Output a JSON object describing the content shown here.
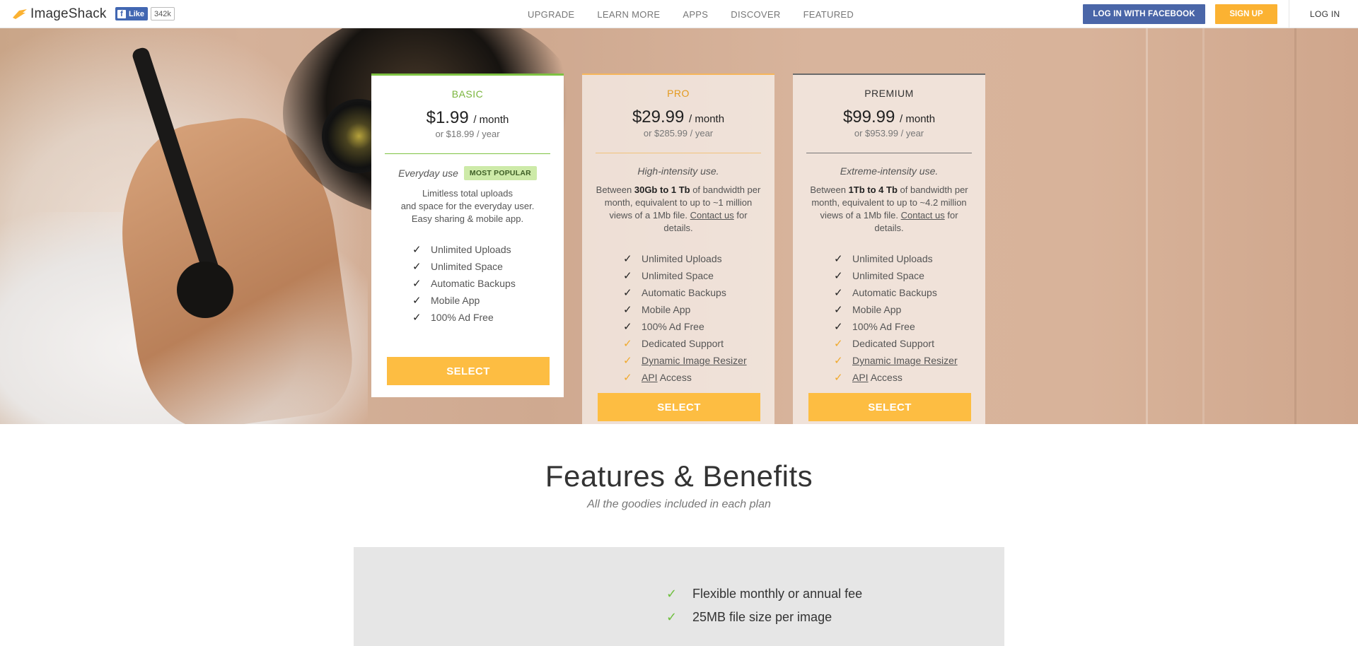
{
  "header": {
    "logo_text": "ImageShack",
    "fb_like_label": "Like",
    "fb_like_count": "342k",
    "nav": [
      "UPGRADE",
      "LEARN MORE",
      "APPS",
      "DISCOVER",
      "FEATURED"
    ],
    "login_facebook": "LOG IN WITH FACEBOOK",
    "signup": "SIGN UP",
    "login": "LOG IN"
  },
  "plans": {
    "basic": {
      "name": "BASIC",
      "price": "$1.99",
      "per": "/ month",
      "yearly": "or $18.99 / year",
      "use": "Everyday use",
      "badge": "MOST POPULAR",
      "desc_lines": [
        "Limitless total uploads",
        "and space for the everyday user.",
        "Easy sharing & mobile app."
      ],
      "features": [
        "Unlimited Uploads",
        "Unlimited Space",
        "Automatic Backups",
        "Mobile App",
        "100% Ad Free"
      ],
      "select": "SELECT"
    },
    "pro": {
      "name": "PRO",
      "price": "$29.99",
      "per": "/ month",
      "yearly": "or $285.99 / year",
      "use": "High-intensity use.",
      "desc_pre": "Between ",
      "desc_bold": "30Gb to 1 Tb",
      "desc_mid": " of bandwidth per month, equivalent to up to ~1 million views of a 1Mb file. ",
      "desc_link": "Contact us",
      "desc_post": " for details.",
      "features": [
        "Unlimited Uploads",
        "Unlimited Space",
        "Automatic Backups",
        "Mobile App",
        "100% Ad Free",
        "Dedicated Support"
      ],
      "feature_resizer": "Dynamic Image Resizer",
      "feature_api": "API",
      "feature_api_rest": " Access",
      "select": "SELECT"
    },
    "premium": {
      "name": "PREMIUM",
      "price": "$99.99",
      "per": "/ month",
      "yearly": "or $953.99 / year",
      "use": "Extreme-intensity use.",
      "desc_pre": "Between ",
      "desc_bold": "1Tb to 4 Tb",
      "desc_mid": " of bandwidth per month, equivalent to up to ~4.2 million views of a 1Mb file. ",
      "desc_link": "Contact us",
      "desc_post": " for details.",
      "features": [
        "Unlimited Uploads",
        "Unlimited Space",
        "Automatic Backups",
        "Mobile App",
        "100% Ad Free",
        "Dedicated Support"
      ],
      "feature_resizer": "Dynamic Image Resizer",
      "feature_api": "API",
      "feature_api_rest": " Access",
      "select": "SELECT"
    }
  },
  "benefits": {
    "title": "Features & Benefits",
    "subtitle": "All the goodies included in each plan",
    "items": [
      "Flexible monthly or annual fee",
      "25MB file size per image"
    ]
  },
  "colors": {
    "accent_yellow": "#fdbd42",
    "facebook_blue": "#4a66a8",
    "basic_green": "#7ec242",
    "pro_orange": "#e39a1e"
  }
}
